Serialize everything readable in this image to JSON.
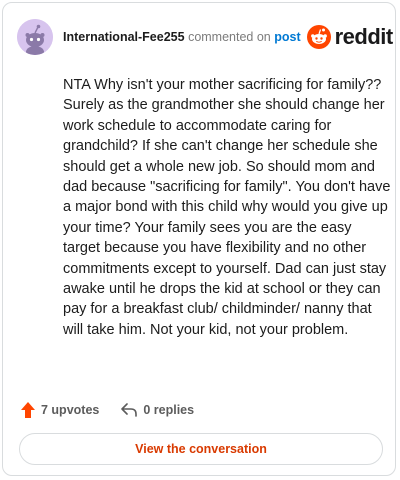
{
  "header": {
    "username": "International-Fee255",
    "action_text": "commented on",
    "post_link": "post",
    "brand": "reddit"
  },
  "comment": {
    "body": "NTA Why isn't your mother sacrificing for family?? Surely as the grandmother she should change her work schedule to accommodate caring for grandchild? If she can't change her schedule she should get a whole new job. So should mom and dad because \"sacrificing for family\". You don't have a major bond with this child why would you give up your time? Your family sees you are the easy target because you have flexibility and no other commitments except to yourself. Dad can just stay awake until he drops the kid at school or they can pay for a breakfast club/ childminder/ nanny that will take him. Not your kid, not your problem."
  },
  "actions": {
    "upvotes": "7 upvotes",
    "replies": "0 replies"
  },
  "footer": {
    "view_label": "View the conversation"
  },
  "colors": {
    "brand_orange": "#ff4500",
    "link_blue": "#0079d3",
    "avatar_bg": "#d7c4ee"
  },
  "icons": {
    "avatar": "snoo-avatar-icon",
    "brand": "reddit-logo-icon",
    "upvote": "upvote-arrow-icon",
    "reply": "reply-arrow-icon"
  }
}
